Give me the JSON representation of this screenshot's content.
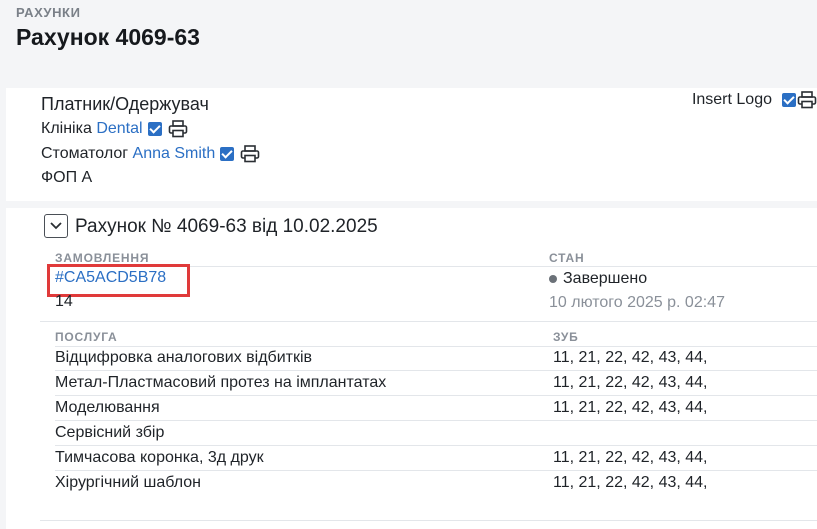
{
  "breadcrumb": "РАХУНКИ",
  "page_title": "Рахунок 4069-63",
  "payer": {
    "title": "Платник/Одержувач",
    "clinic_label": "Клініка",
    "clinic_name": "Dental",
    "dentist_label": "Стоматолог",
    "dentist_name": "Anna Smith",
    "entity": "ФОП А"
  },
  "insert_logo_label": "Insert Logo",
  "invoice": {
    "heading": "Рахунок № 4069-63 від 10.02.2025",
    "order_header": "ЗАМОВЛЕННЯ",
    "status_header": "СТАН",
    "order_id": "#CA5ACD5B78",
    "order_sub": "14",
    "status": "Завершено",
    "status_date": "10 лютого 2025 р. 02:47",
    "service_header": "ПОСЛУГА",
    "tooth_header": "ЗУБ",
    "services": [
      {
        "name": "Відцифровка аналогових відбитків",
        "teeth": "11, 21, 22, 42, 43, 44,"
      },
      {
        "name": "Метал-Пластмасовий протез на імплантатах",
        "teeth": "11, 21, 22, 42, 43, 44,"
      },
      {
        "name": "Моделювання",
        "teeth": "11, 21, 22, 42, 43, 44,"
      },
      {
        "name": "Сервісний збір",
        "teeth": ""
      },
      {
        "name": "Тимчасова коронка, 3д друк",
        "teeth": "11, 21, 22, 42, 43, 44,"
      },
      {
        "name": "Хірургічний шаблон",
        "teeth": "11, 21, 22, 42, 43, 44,"
      }
    ]
  },
  "colors": {
    "accent": "#2b6fc4",
    "highlight": "#e03a3a"
  }
}
